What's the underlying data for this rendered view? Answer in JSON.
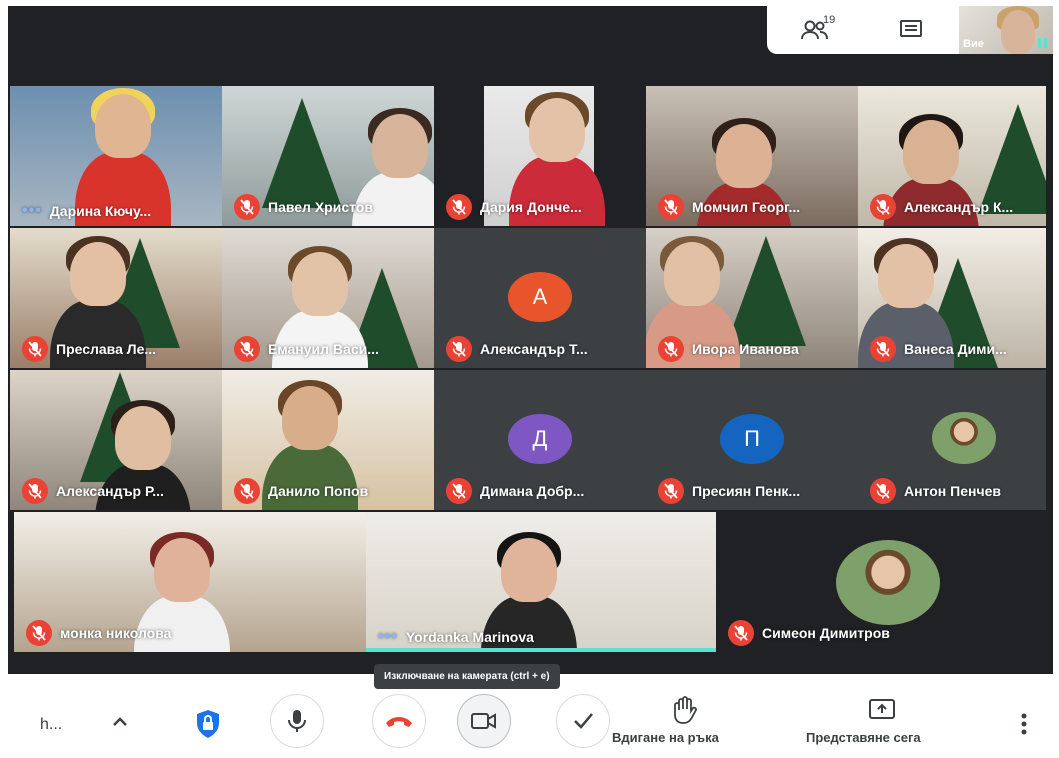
{
  "topbar": {
    "participants_count": "19",
    "self_label": "Вие"
  },
  "tiles": [
    {
      "name": "Дарина Кючу...",
      "status": "speaking"
    },
    {
      "name": "Павел Христов",
      "status": "muted"
    },
    {
      "name": "Дария Донче...",
      "status": "muted"
    },
    {
      "name": "Момчил Георг...",
      "status": "muted"
    },
    {
      "name": "Александър К...",
      "status": "muted"
    },
    {
      "name": "Преслава Ле...",
      "status": "muted"
    },
    {
      "name": "Емануил Васи...",
      "status": "muted"
    },
    {
      "name": "Александър Т...",
      "status": "muted",
      "avatar_letter": "А",
      "avatar_color": "#e8542c"
    },
    {
      "name": "Ивора Иванова",
      "status": "muted"
    },
    {
      "name": "Ванеса Дими...",
      "status": "muted"
    },
    {
      "name": "Александър Р...",
      "status": "muted"
    },
    {
      "name": "Данило Попов",
      "status": "muted"
    },
    {
      "name": "Димана Добр...",
      "status": "muted",
      "avatar_letter": "Д",
      "avatar_color": "#7e57c2"
    },
    {
      "name": "Пресиян Пенк...",
      "status": "muted",
      "avatar_letter": "П",
      "avatar_color": "#1565c0"
    },
    {
      "name": "Антон Пенчев",
      "status": "muted"
    },
    {
      "name": "монка николова",
      "status": "muted"
    },
    {
      "name": "Yordanka Marinova",
      "status": "speaking"
    },
    {
      "name": "Симеон Димитров",
      "status": "muted"
    }
  ],
  "tooltip": "Изключване на камерата (ctrl + e)",
  "controls": {
    "meeting_code": "h...",
    "raise_hand_label": "Вдигане на ръка",
    "present_label": "Представяне сега"
  },
  "colors": {
    "mute_red": "#ea4335",
    "speaking_bar": "#5ee0cf",
    "dots": "#8ab4f8"
  }
}
